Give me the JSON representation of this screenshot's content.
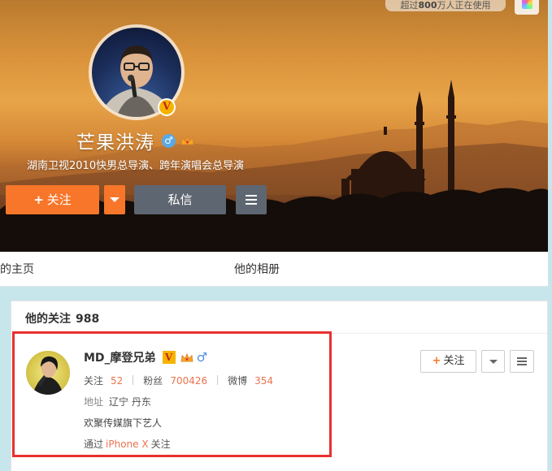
{
  "cover": {
    "users_badge": {
      "prefix": "超过",
      "number": "800",
      "suffix": "万人正在使用"
    },
    "profile": {
      "nickname": "芒果洪涛",
      "bio": "湖南卫视2010快男总导演、跨年演唱会总导演",
      "verified_glyph": "V",
      "gender_glyph": "♂"
    },
    "actions": {
      "follow_label": "关注",
      "follow_plus": "+",
      "message_label": "私信"
    }
  },
  "tabs": [
    {
      "label": "的主页"
    },
    {
      "label": "他的相册"
    }
  ],
  "following": {
    "title": "他的关注",
    "count": "988",
    "users": [
      {
        "name": "MD_摩登兄弟",
        "verified_glyph": "V",
        "gender_glyph": "♂",
        "stats": [
          {
            "label": "关注",
            "value": "52"
          },
          {
            "label": "粉丝",
            "value": "700426"
          },
          {
            "label": "微博",
            "value": "354"
          }
        ],
        "address_label": "地址",
        "address": "辽宁 丹东",
        "description": "欢聚传媒旗下艺人",
        "via_prefix": "通过",
        "via_device": "iPhone X",
        "via_suffix": "关注",
        "follow_label": "关注",
        "follow_plus": "+"
      }
    ]
  },
  "colors": {
    "accent_orange": "#f7762a",
    "button_gray": "#5e6671",
    "highlight_red": "#e8312f",
    "number_orange": "#eb7350",
    "page_bg": "#c7e6ec"
  },
  "icons": [
    "skin-icon",
    "v-badge-icon",
    "male-icon",
    "crown-icon",
    "chevron-down-icon",
    "menu-icon",
    "plus-icon"
  ]
}
